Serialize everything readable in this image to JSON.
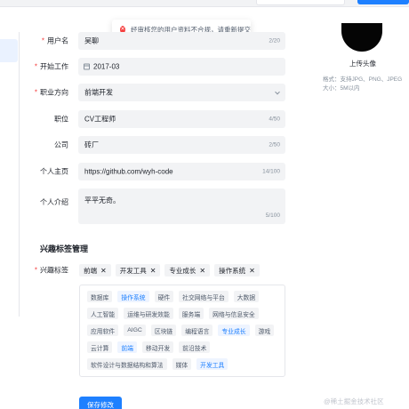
{
  "toast": {
    "message": "经审核您的用户资料不合规，请重新提交",
    "icon": "error-icon"
  },
  "form": {
    "username": {
      "label": "用户名",
      "value": "吴聊",
      "count": "2/20"
    },
    "start_work": {
      "label": "开始工作",
      "value": "2017-03"
    },
    "career": {
      "label": "职业方向",
      "value": "前端开发"
    },
    "position": {
      "label": "职位",
      "value": "CV工程师",
      "count": "4/50"
    },
    "company": {
      "label": "公司",
      "value": "砖厂",
      "count": "2/50"
    },
    "homepage": {
      "label": "个人主页",
      "value": "https://github.com/wyh-code",
      "count": "14/100"
    },
    "intro": {
      "label": "个人介绍",
      "value": "平平无奇。",
      "count": "5/100"
    }
  },
  "avatar": {
    "upload_label": "上传头像",
    "hint_format": "格式：支持JPG、PNG、JPEG",
    "hint_size": "大小：5M以内"
  },
  "interest": {
    "section_title": "兴趣标签管理",
    "label": "兴趣标签",
    "selected": [
      "前端",
      "开发工具",
      "专业成长",
      "操作系统"
    ],
    "options": [
      [
        {
          "text": "数据库",
          "sel": false
        },
        {
          "text": "操作系统",
          "sel": true
        },
        {
          "text": "硬件",
          "sel": false
        },
        {
          "text": "社交网络与平台",
          "sel": false
        },
        {
          "text": "大数据",
          "sel": false
        }
      ],
      [
        {
          "text": "人工智能",
          "sel": false
        },
        {
          "text": "运维与研发效能",
          "sel": false
        },
        {
          "text": "服务端",
          "sel": false
        },
        {
          "text": "网络与信息安全",
          "sel": false
        }
      ],
      [
        {
          "text": "应用软件",
          "sel": false
        },
        {
          "text": "AIGC",
          "sel": false
        },
        {
          "text": "区块链",
          "sel": false
        },
        {
          "text": "编程语言",
          "sel": false
        },
        {
          "text": "专业成长",
          "sel": true
        },
        {
          "text": "游戏",
          "sel": false
        }
      ],
      [
        {
          "text": "云计算",
          "sel": false
        },
        {
          "text": "前端",
          "sel": true
        },
        {
          "text": "移动开发",
          "sel": false
        },
        {
          "text": "前沿技术",
          "sel": false
        }
      ],
      [
        {
          "text": "软件设计与数据结构和算法",
          "sel": false
        },
        {
          "text": "媒体",
          "sel": false
        },
        {
          "text": "开发工具",
          "sel": true
        }
      ]
    ]
  },
  "actions": {
    "save_label": "保存修改"
  },
  "watermark": "@稀土掘金技术社区",
  "colors": {
    "primary": "#1e80ff",
    "required": "#f53f3f",
    "field_bg": "#f2f3f5"
  }
}
